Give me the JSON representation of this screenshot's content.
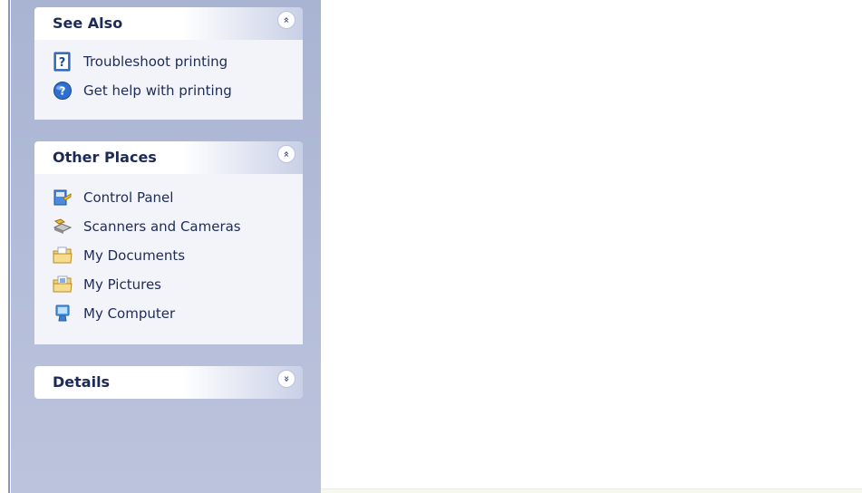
{
  "sidebar": {
    "see_also": {
      "title": "See Also",
      "toggle": "»",
      "items": [
        {
          "label": "Troubleshoot printing",
          "icon": "help-topic-icon"
        },
        {
          "label": "Get help with printing",
          "icon": "help-globe-icon"
        }
      ]
    },
    "other_places": {
      "title": "Other Places",
      "toggle": "»",
      "items": [
        {
          "label": "Control Panel",
          "icon": "control-panel-icon"
        },
        {
          "label": "Scanners and Cameras",
          "icon": "scanner-camera-icon"
        },
        {
          "label": "My Documents",
          "icon": "folder-documents-icon"
        },
        {
          "label": "My Pictures",
          "icon": "folder-pictures-icon"
        },
        {
          "label": "My Computer",
          "icon": "computer-icon"
        }
      ]
    },
    "details": {
      "title": "Details",
      "toggle": "»"
    }
  },
  "colors": {
    "taskpane_bg": "#a8b4d2",
    "panel_body": "#f3f4f9",
    "link_text": "#1e2b57"
  }
}
